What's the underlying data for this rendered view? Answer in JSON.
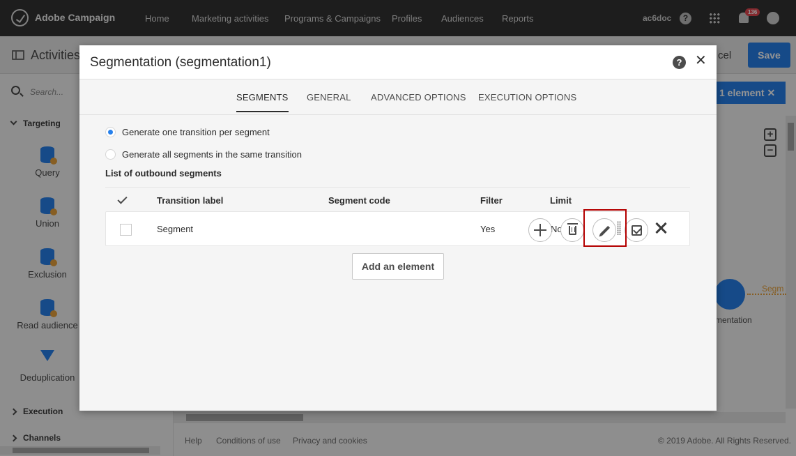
{
  "topbar": {
    "brand": "Adobe Campaign",
    "nav": [
      "Home",
      "Marketing activities",
      "Programs & Campaigns",
      "Profiles",
      "Audiences",
      "Reports"
    ],
    "user": "ac6doc",
    "help": "?",
    "notifications": "136"
  },
  "subbar": {
    "title": "Activities",
    "cancel": "cel",
    "save": "Save",
    "selection_chip": "1 element"
  },
  "sidebar": {
    "search_placeholder": "Search...",
    "groups": {
      "targeting": "Targeting",
      "execution": "Execution",
      "channels": "Channels"
    },
    "activities": [
      "Query",
      "Union",
      "Exclusion",
      "Read audience",
      "Deduplication"
    ]
  },
  "canvas": {
    "node_label": "mentation",
    "transition_label": "Segm"
  },
  "footer": {
    "links": [
      "Help",
      "Conditions of use",
      "Privacy and cookies"
    ],
    "copyright": "© 2019 Adobe. All Rights Reserved."
  },
  "dialog": {
    "title": "Segmentation (segmentation1)",
    "help": "?",
    "close": "✕",
    "tabs": [
      "SEGMENTS",
      "GENERAL",
      "ADVANCED OPTIONS",
      "EXECUTION OPTIONS"
    ],
    "active_tab": "SEGMENTS",
    "radios": [
      {
        "label": "Generate one transition per segment",
        "checked": true
      },
      {
        "label": "Generate all segments in the same transition",
        "checked": false
      }
    ],
    "list_label": "List of outbound segments",
    "columns": [
      "Transition label",
      "Segment code",
      "Filter",
      "Limit"
    ],
    "rows": [
      {
        "transition_label": "Segment",
        "segment_code": "",
        "filter": "Yes",
        "limit": "No"
      }
    ],
    "add_button": "Add an element"
  },
  "colors": {
    "accent": "#2680eb",
    "highlight": "#b40000",
    "topbar": "#323232"
  }
}
